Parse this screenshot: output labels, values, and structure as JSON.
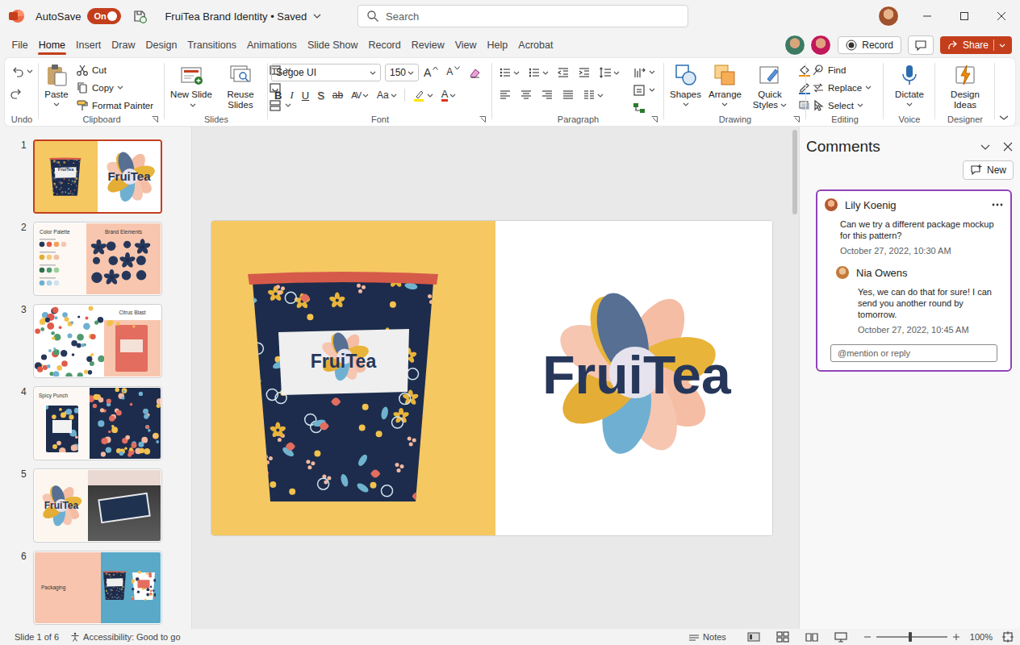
{
  "window": {
    "title": "FruiTea Brand Identity • Saved"
  },
  "autosave": {
    "label": "AutoSave",
    "state": "On",
    "on": true
  },
  "search": {
    "placeholder": "Search"
  },
  "menu": [
    {
      "label": "File",
      "selected": false
    },
    {
      "label": "Home",
      "selected": true
    },
    {
      "label": "Insert",
      "selected": false
    },
    {
      "label": "Draw",
      "selected": false
    },
    {
      "label": "Design",
      "selected": false
    },
    {
      "label": "Transitions",
      "selected": false
    },
    {
      "label": "Animations",
      "selected": false
    },
    {
      "label": "Slide Show",
      "selected": false
    },
    {
      "label": "Record",
      "selected": false
    },
    {
      "label": "Review",
      "selected": false
    },
    {
      "label": "View",
      "selected": false
    },
    {
      "label": "Help",
      "selected": false
    },
    {
      "label": "Acrobat",
      "selected": false
    }
  ],
  "header_actions": {
    "record": "Record",
    "share": "Share"
  },
  "ribbon": {
    "undo": {
      "group": "Undo"
    },
    "clipboard": {
      "group": "Clipboard",
      "paste": "Paste",
      "cut": "Cut",
      "copy": "Copy",
      "format_painter": "Format Painter"
    },
    "slides": {
      "group": "Slides",
      "new_slide": "New Slide",
      "reuse_slides": "Reuse Slides"
    },
    "font": {
      "group": "Font",
      "family": "Segoe UI",
      "size": "150",
      "size_buttons": [
        "A",
        "A"
      ],
      "formats": [
        {
          "label": "B",
          "kind": "bold"
        },
        {
          "label": "I",
          "kind": "italic"
        },
        {
          "label": "U",
          "kind": "underline"
        },
        {
          "label": "S",
          "kind": "shadow"
        },
        {
          "label": "ab",
          "kind": "strike"
        },
        {
          "label": "AV",
          "kind": "spacing"
        },
        {
          "label": "Aa",
          "kind": "case"
        }
      ],
      "font_color": "A"
    },
    "paragraph": {
      "group": "Paragraph"
    },
    "drawing": {
      "group": "Drawing",
      "shapes": "Shapes",
      "arrange": "Arrange",
      "quick_styles": "Quick Styles"
    },
    "editing": {
      "group": "Editing",
      "find": "Find",
      "replace": "Replace",
      "select": "Select"
    },
    "voice": {
      "group": "Voice",
      "dictate": "Dictate"
    },
    "designer": {
      "group": "Designer",
      "design_ideas": "Design Ideas"
    }
  },
  "slides": [
    {
      "number": "1",
      "selected": true,
      "kind": "cover",
      "texts": [
        "FruiTea",
        "FruiTea"
      ]
    },
    {
      "number": "2",
      "selected": false,
      "kind": "palette",
      "texts": [
        "Color Palette",
        "Brand Elements"
      ]
    },
    {
      "number": "3",
      "selected": false,
      "kind": "pattern",
      "texts": [
        "Citrus Blast"
      ]
    },
    {
      "number": "4",
      "selected": false,
      "kind": "product",
      "texts": [
        "Spicy Punch"
      ]
    },
    {
      "number": "5",
      "selected": false,
      "kind": "sign",
      "texts": [
        "FruiTea"
      ]
    },
    {
      "number": "6",
      "selected": false,
      "kind": "packaging",
      "texts": [
        "Packaging"
      ]
    }
  ],
  "current_slide": {
    "cup_label": "FruiTea",
    "logo": "FruiTea"
  },
  "comments": {
    "title": "Comments",
    "new": "New",
    "thread": [
      {
        "author": "Lily Koenig",
        "text": "Can we try a different package mockup for this pattern?",
        "time": "October 27, 2022, 10:30 AM"
      },
      {
        "author": "Nia Owens",
        "text": "Yes, we can do that for sure! I can send you another round by tomorrow.",
        "time": "October 27, 2022, 10:45 AM"
      }
    ],
    "reply_placeholder": "@mention or reply"
  },
  "status_bar": {
    "slide": "Slide 1 of 6",
    "accessibility": "Accessibility: Good to go",
    "notes": "Notes",
    "zoom": "100%",
    "zoom_level": 0.48
  }
}
